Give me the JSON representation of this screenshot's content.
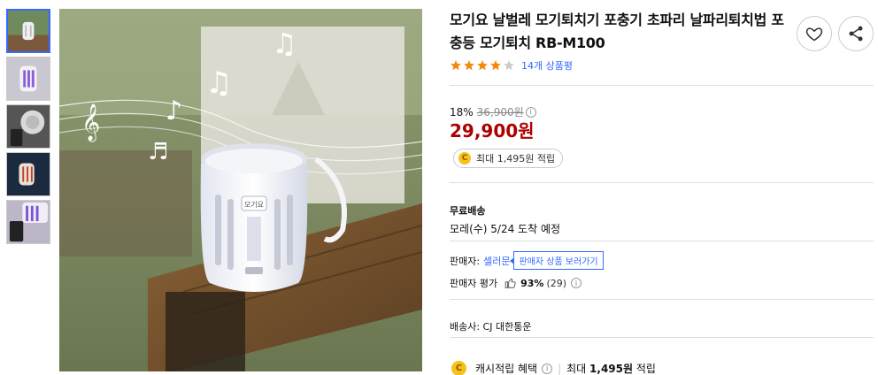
{
  "gallery": {
    "thumbnails": [
      {
        "name": "thumb-lantern-outdoor"
      },
      {
        "name": "thumb-lantern-uv-light"
      },
      {
        "name": "thumb-lantern-top-phone"
      },
      {
        "name": "thumb-lantern-night"
      },
      {
        "name": "thumb-lantern-with-phone"
      }
    ],
    "main_badge": "모기요"
  },
  "product": {
    "title": "모기요 날벌레 모기퇴치기 포충기 초파리 날파리퇴치법 포충등 모기퇴치 RB-M100",
    "rating_stars": 4,
    "review_count": "14개 상품평"
  },
  "price": {
    "discount_rate": "18%",
    "original": "36,900원",
    "sale": "29,900원",
    "cash_reward": "최대 1,495원 적립"
  },
  "shipping": {
    "title": "무료배송",
    "eta": "모레(수) 5/24 도착 예정"
  },
  "seller": {
    "label": "판매자:",
    "name": "셀러문",
    "tooltip": "판매자 상품 보러가기",
    "rating_label": "판매자 평가",
    "rating_pct": "93%",
    "rating_count": "(29)"
  },
  "carrier": "배송사: CJ 대한통운",
  "benefit": {
    "label": "캐시적립 혜택",
    "amount_prefix": "최대",
    "amount": "1,495원",
    "amount_suffix": "적립"
  },
  "colors": {
    "accent_blue": "#346aff",
    "sale_red": "#ae0000",
    "star_orange": "#f28b0c",
    "coin_yellow": "#f8c01a"
  }
}
